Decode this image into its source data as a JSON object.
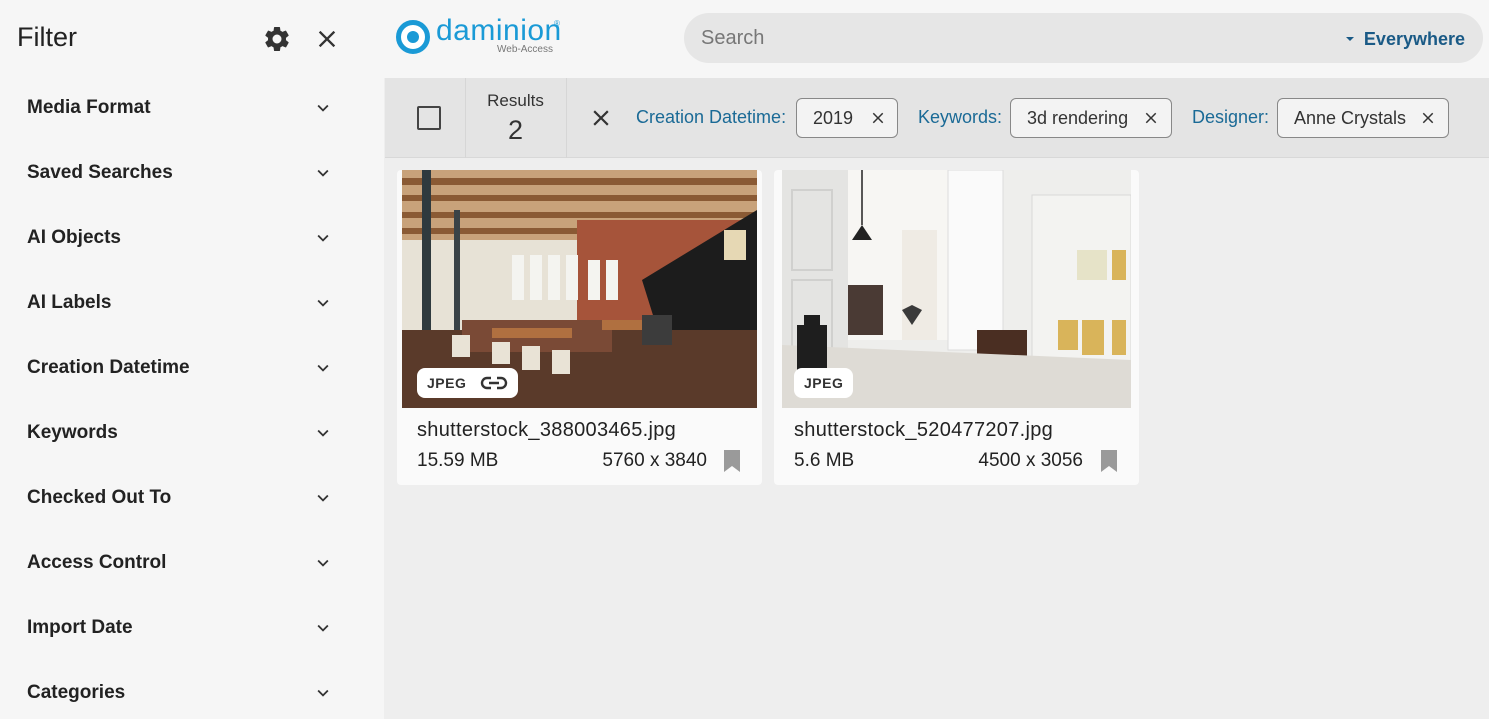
{
  "sidebar": {
    "title": "Filter",
    "items": [
      {
        "label": "Media Format"
      },
      {
        "label": "Saved Searches"
      },
      {
        "label": "AI Objects"
      },
      {
        "label": "AI Labels"
      },
      {
        "label": "Creation Datetime"
      },
      {
        "label": "Keywords"
      },
      {
        "label": "Checked Out To"
      },
      {
        "label": "Access Control"
      },
      {
        "label": "Import Date"
      },
      {
        "label": "Categories"
      }
    ]
  },
  "header": {
    "logo_text": "daminion",
    "logo_subtext": "Web-Access",
    "search_placeholder": "Search",
    "scope_label": "Everywhere"
  },
  "results": {
    "label": "Results",
    "count": "2",
    "filters": [
      {
        "label": "Creation Datetime:",
        "value": "2019"
      },
      {
        "label": "Keywords:",
        "value": "3d rendering"
      },
      {
        "label": "Designer:",
        "value": "Anne Crystals"
      }
    ]
  },
  "cards": [
    {
      "filename": "shutterstock_388003465.jpg",
      "format": "JPEG",
      "size": "15.59 MB",
      "dimensions": "5760 x 3840",
      "has_link": true
    },
    {
      "filename": "shutterstock_520477207.jpg",
      "format": "JPEG",
      "size": "5.6 MB",
      "dimensions": "4500 x 3056",
      "has_link": false
    }
  ],
  "colors": {
    "accent": "#1a9ad6",
    "link": "#1a6a96"
  }
}
